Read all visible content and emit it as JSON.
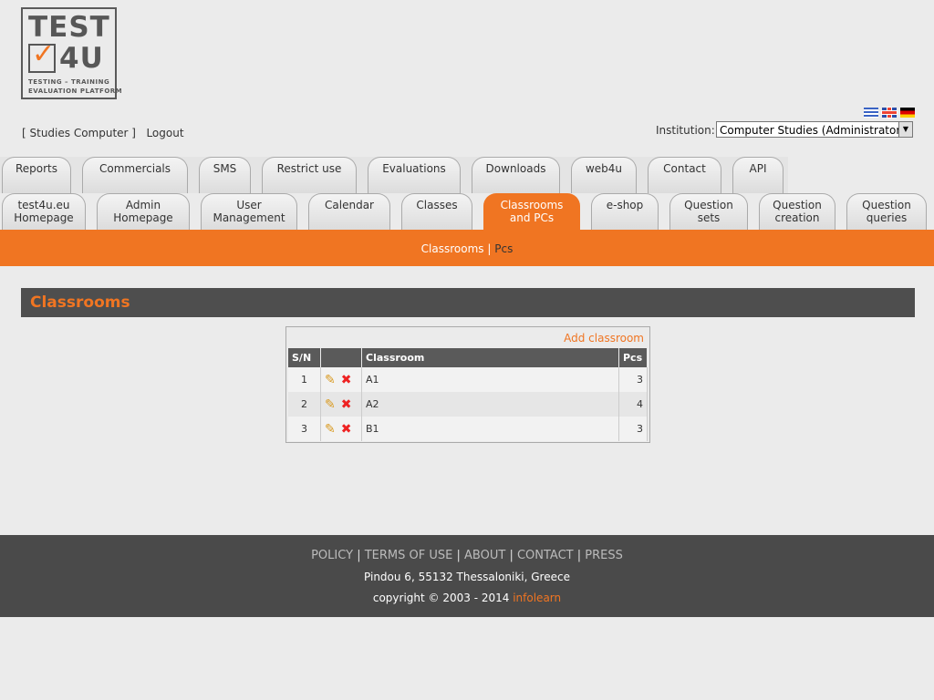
{
  "logo": {
    "line1": "TEST",
    "line2": "4U",
    "tag1": "TESTING – TRAINING",
    "tag2": "EVALUATION PLATFORM"
  },
  "user": {
    "name": "Studies Computer",
    "logout": "Logout"
  },
  "institution": {
    "label": "Institution:",
    "value": "Computer Studies (Administrator)"
  },
  "tabs_row1": [
    "Reports",
    "Commercials",
    "SMS",
    "Restrict use",
    "Evaluations",
    "Downloads",
    "web4u",
    "Contact",
    "API"
  ],
  "tabs_row2": [
    {
      "line1": "test4u.eu",
      "line2": "Homepage"
    },
    {
      "line1": "Admin",
      "line2": "Homepage"
    },
    {
      "line1": "User",
      "line2": "Management"
    },
    {
      "line1": "Calendar",
      "line2": ""
    },
    {
      "line1": "Classes",
      "line2": ""
    },
    {
      "line1": "Classrooms",
      "line2": "and PCs"
    },
    {
      "line1": "e-shop",
      "line2": ""
    },
    {
      "line1": "Question",
      "line2": "sets"
    },
    {
      "line1": "Question",
      "line2": "creation"
    },
    {
      "line1": "Question",
      "line2": "queries"
    }
  ],
  "subnav": {
    "item1": "Classrooms",
    "sep": "|",
    "item2": "Pcs"
  },
  "section": {
    "title": "Classrooms"
  },
  "table": {
    "add_label": "Add classroom",
    "headers": [
      "S/N",
      "",
      "Classroom",
      "Pcs"
    ],
    "rows": [
      {
        "sn": "1",
        "classroom": "A1",
        "pcs": "3"
      },
      {
        "sn": "2",
        "classroom": "A2",
        "pcs": "4"
      },
      {
        "sn": "3",
        "classroom": "B1",
        "pcs": "3"
      }
    ]
  },
  "footer": {
    "links": [
      "POLICY",
      "TERMS OF USE",
      "ABOUT",
      "CONTACT",
      "PRESS"
    ],
    "address": "Pindou 6, 55132 Thessaloniki, Greece",
    "copyright": "copyright © 2003 - 2014",
    "brand": "infolearn"
  },
  "colors": {
    "accent": "#f07522",
    "dark": "#4e4e4e"
  }
}
